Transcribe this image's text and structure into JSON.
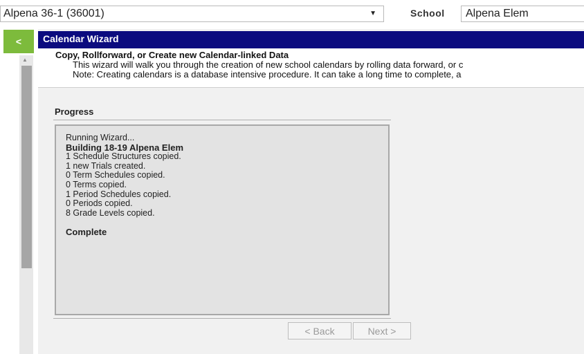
{
  "topbar": {
    "district_value": "Alpena 36-1 (36001)",
    "school_label": "School",
    "school_value": "Alpena Elem"
  },
  "icons": {
    "collapse": "chevron-left-icon",
    "dropdown": "caret-down-icon"
  },
  "colors": {
    "collapse_button": "#7dbb3c",
    "titlebar": "#0b0b7f"
  },
  "wizard": {
    "title": "Calendar Wizard",
    "heading": "Copy, Rollforward, or Create new Calendar-linked Data",
    "description": "This wizard will walk you through the creation of new school calendars by rolling data forward, or c",
    "note": "Note: Creating calendars is a database intensive procedure. It can take a long time to complete, a"
  },
  "progress": {
    "label": "Progress",
    "running": "Running Wizard...",
    "building": "Building 18-19 Alpena Elem",
    "lines": [
      "1 Schedule Structures copied.",
      "1 new Trials created.",
      "0 Term Schedules copied.",
      "0 Terms copied.",
      "1 Period Schedules copied.",
      "0 Periods copied.",
      "8 Grade Levels copied."
    ],
    "status": "Complete"
  },
  "buttons": {
    "back": "< Back",
    "next": "Next >"
  }
}
